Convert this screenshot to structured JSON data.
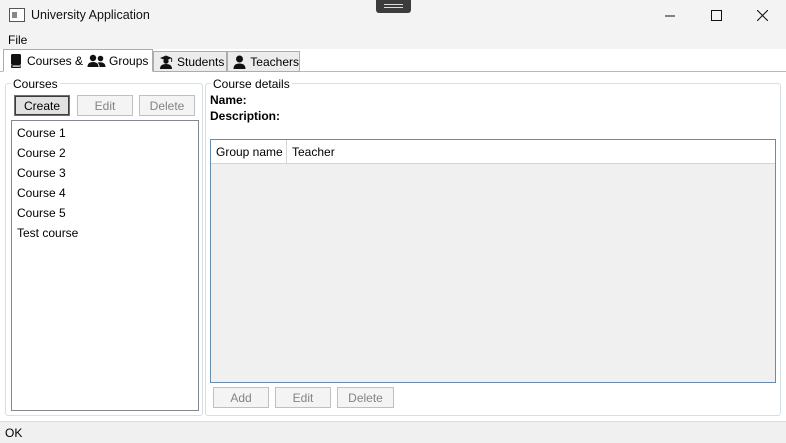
{
  "window": {
    "title": "University Application",
    "minimize_icon": "minimize-icon",
    "maximize_icon": "maximize-icon",
    "close_icon": "close-icon"
  },
  "menu": {
    "file": "File"
  },
  "tabs": [
    {
      "label_a": "Courses &",
      "label_b": "Groups",
      "icon_a": "book-icon",
      "icon_b": "people-icon",
      "selected": true
    },
    {
      "label": "Students",
      "icon": "graduate-icon"
    },
    {
      "label": "Teachers",
      "icon": "person-icon"
    }
  ],
  "courses": {
    "legend": "Courses",
    "create": "Create",
    "edit": "Edit",
    "delete": "Delete",
    "items": [
      "Course 1",
      "Course 2",
      "Course 3",
      "Course 4",
      "Course 5",
      "Test course"
    ]
  },
  "details": {
    "legend": "Course details",
    "name_label": "Name:",
    "description_label": "Description:",
    "columns": [
      "Group name",
      "Teacher"
    ],
    "add": "Add",
    "edit": "Edit",
    "delete": "Delete"
  },
  "status": {
    "text": "OK"
  }
}
